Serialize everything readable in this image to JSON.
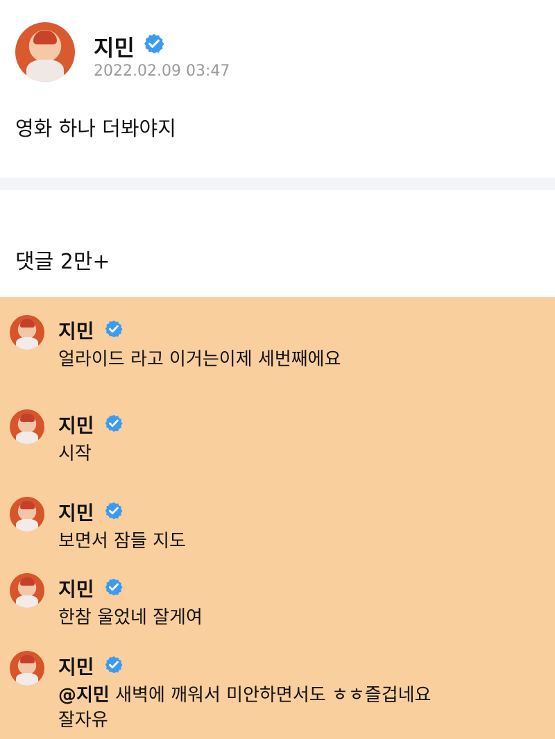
{
  "post": {
    "author": "지민",
    "timestamp": "2022.02.09 03:47",
    "body": "영화 하나 더봐야지"
  },
  "comments_section": {
    "title": "댓글 2만+"
  },
  "comments": [
    {
      "author": "지민",
      "text": "얼라이드 라고 이거는이제 세번째에요"
    },
    {
      "author": "지민",
      "text": "시작"
    },
    {
      "author": "지민",
      "text": "보면서 잠들 지도"
    },
    {
      "author": "지민",
      "text": "한참 울었네 잘게여"
    },
    {
      "author": "지민",
      "mention": "@지민",
      "text": " 새벽에 깨워서 미안하면서도 ㅎㅎ즐겁네요",
      "text_line2": "잘자유"
    }
  ],
  "colors": {
    "verified_badge": "#3b9bf0",
    "highlight_panel": "#facf9e",
    "timestamp": "#9a9a9a"
  },
  "icons": {
    "verified": "verified-badge-icon",
    "avatar": "profile-avatar"
  }
}
